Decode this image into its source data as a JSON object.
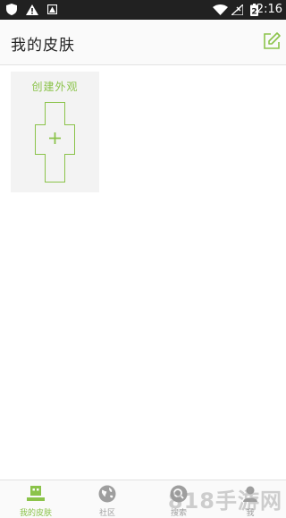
{
  "status_bar": {
    "time": "2:16",
    "battery_level": "2",
    "icons": [
      "shield-icon",
      "warning-icon",
      "image-notification-icon",
      "wifi-icon",
      "no-signal-icon",
      "battery-icon"
    ]
  },
  "header": {
    "title": "我的皮肤",
    "action_icon": "edit-icon"
  },
  "main": {
    "create_card": {
      "label": "创建外观",
      "icon": "plus-icon"
    }
  },
  "bottom_nav": {
    "items": [
      {
        "label": "我的皮肤",
        "icon": "skin-icon",
        "active": true
      },
      {
        "label": "社区",
        "icon": "globe-icon",
        "active": false
      },
      {
        "label": "搜索",
        "icon": "search-icon",
        "active": false
      },
      {
        "label": "我",
        "icon": "profile-icon",
        "active": false
      }
    ]
  },
  "watermark": "818手游网",
  "colors": {
    "accent": "#8bc34a",
    "status_bar": "#212121",
    "inactive": "#9e9e9e"
  }
}
